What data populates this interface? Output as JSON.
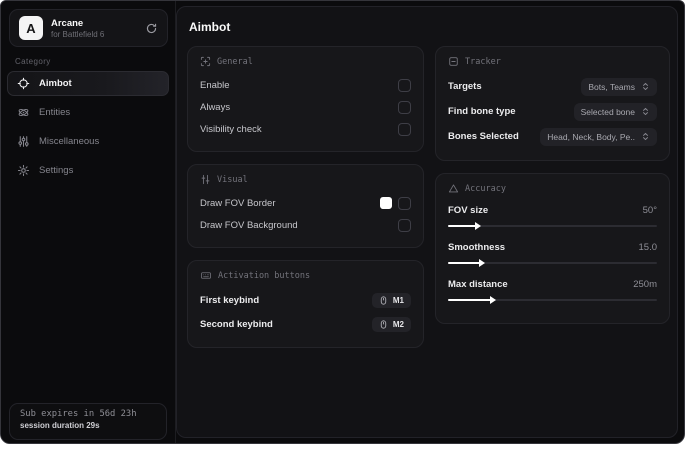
{
  "app": {
    "name": "Arcane",
    "subtitle": "for Battlefield 6",
    "logo_letter": "A"
  },
  "sidebar": {
    "category_label": "Category",
    "items": [
      {
        "label": "Aimbot",
        "icon": "crosshair-icon",
        "active": true
      },
      {
        "label": "Entities",
        "icon": "atom-icon",
        "active": false
      },
      {
        "label": "Miscellaneous",
        "icon": "sliders-icon",
        "active": false
      },
      {
        "label": "Settings",
        "icon": "gear-icon",
        "active": false
      }
    ],
    "subscription": {
      "expires": "Sub expires in 56d 23h",
      "session": "session duration 29s"
    }
  },
  "main": {
    "title": "Aimbot",
    "cards": {
      "general": {
        "title": "General",
        "rows": [
          {
            "label": "Enable",
            "checked": false
          },
          {
            "label": "Always",
            "checked": false
          },
          {
            "label": "Visibility check",
            "checked": false
          }
        ]
      },
      "visual": {
        "title": "Visual",
        "rows": [
          {
            "label": "Draw FOV Border",
            "swatch": "#ffffff",
            "checked": false
          },
          {
            "label": "Draw FOV Background",
            "checked": false
          }
        ]
      },
      "activation": {
        "title": "Activation buttons",
        "rows": [
          {
            "label": "First keybind",
            "key": "M1"
          },
          {
            "label": "Second keybind",
            "key": "M2"
          }
        ]
      },
      "tracker": {
        "title": "Tracker",
        "rows": [
          {
            "label": "Targets",
            "value": "Bots, Teams"
          },
          {
            "label": "Find bone type",
            "value": "Selected bone"
          },
          {
            "label": "Bones Selected",
            "value": "Head, Neck, Body, Pe.."
          }
        ]
      },
      "accuracy": {
        "title": "Accuracy",
        "sliders": [
          {
            "label": "FOV size",
            "value": "50°",
            "percent": 14
          },
          {
            "label": "Smoothness",
            "value": "15.0",
            "percent": 16
          },
          {
            "label": "Max distance",
            "value": "250m",
            "percent": 21
          }
        ]
      }
    }
  }
}
